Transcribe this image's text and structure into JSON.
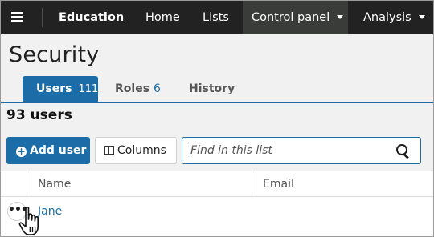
{
  "nav": {
    "app_name": "Education",
    "items": [
      {
        "label": "Home"
      },
      {
        "label": "Lists"
      },
      {
        "label": "Control panel"
      },
      {
        "label": "Analysis"
      }
    ]
  },
  "page": {
    "title": "Security",
    "tabs": [
      {
        "label": "Users",
        "count": "111",
        "active": true
      },
      {
        "label": "Roles",
        "count": "6",
        "active": false
      },
      {
        "label": "History",
        "count": "",
        "active": false
      }
    ],
    "user_count": "93 users"
  },
  "toolbar": {
    "add_label": "Add user",
    "columns_label": "Columns",
    "search_placeholder": "Find in this list",
    "search_value": ""
  },
  "table": {
    "columns": [
      "Name",
      "Email"
    ],
    "rows": [
      {
        "menu": "•••",
        "name": "Jane",
        "email": ""
      }
    ]
  },
  "colors": {
    "topbar": "#222222",
    "active_nav": "#3a3c3a",
    "accent": "#1c6da7",
    "page_bg": "#f1f1f1"
  },
  "icons": {
    "menu": "hamburger-menu-icon",
    "add": "plus-circle-icon",
    "columns": "columns-icon",
    "search": "search-icon",
    "dropdown": "caret-down-icon",
    "row_menu": "ellipsis-icon",
    "pointer": "hand-cursor-icon"
  }
}
